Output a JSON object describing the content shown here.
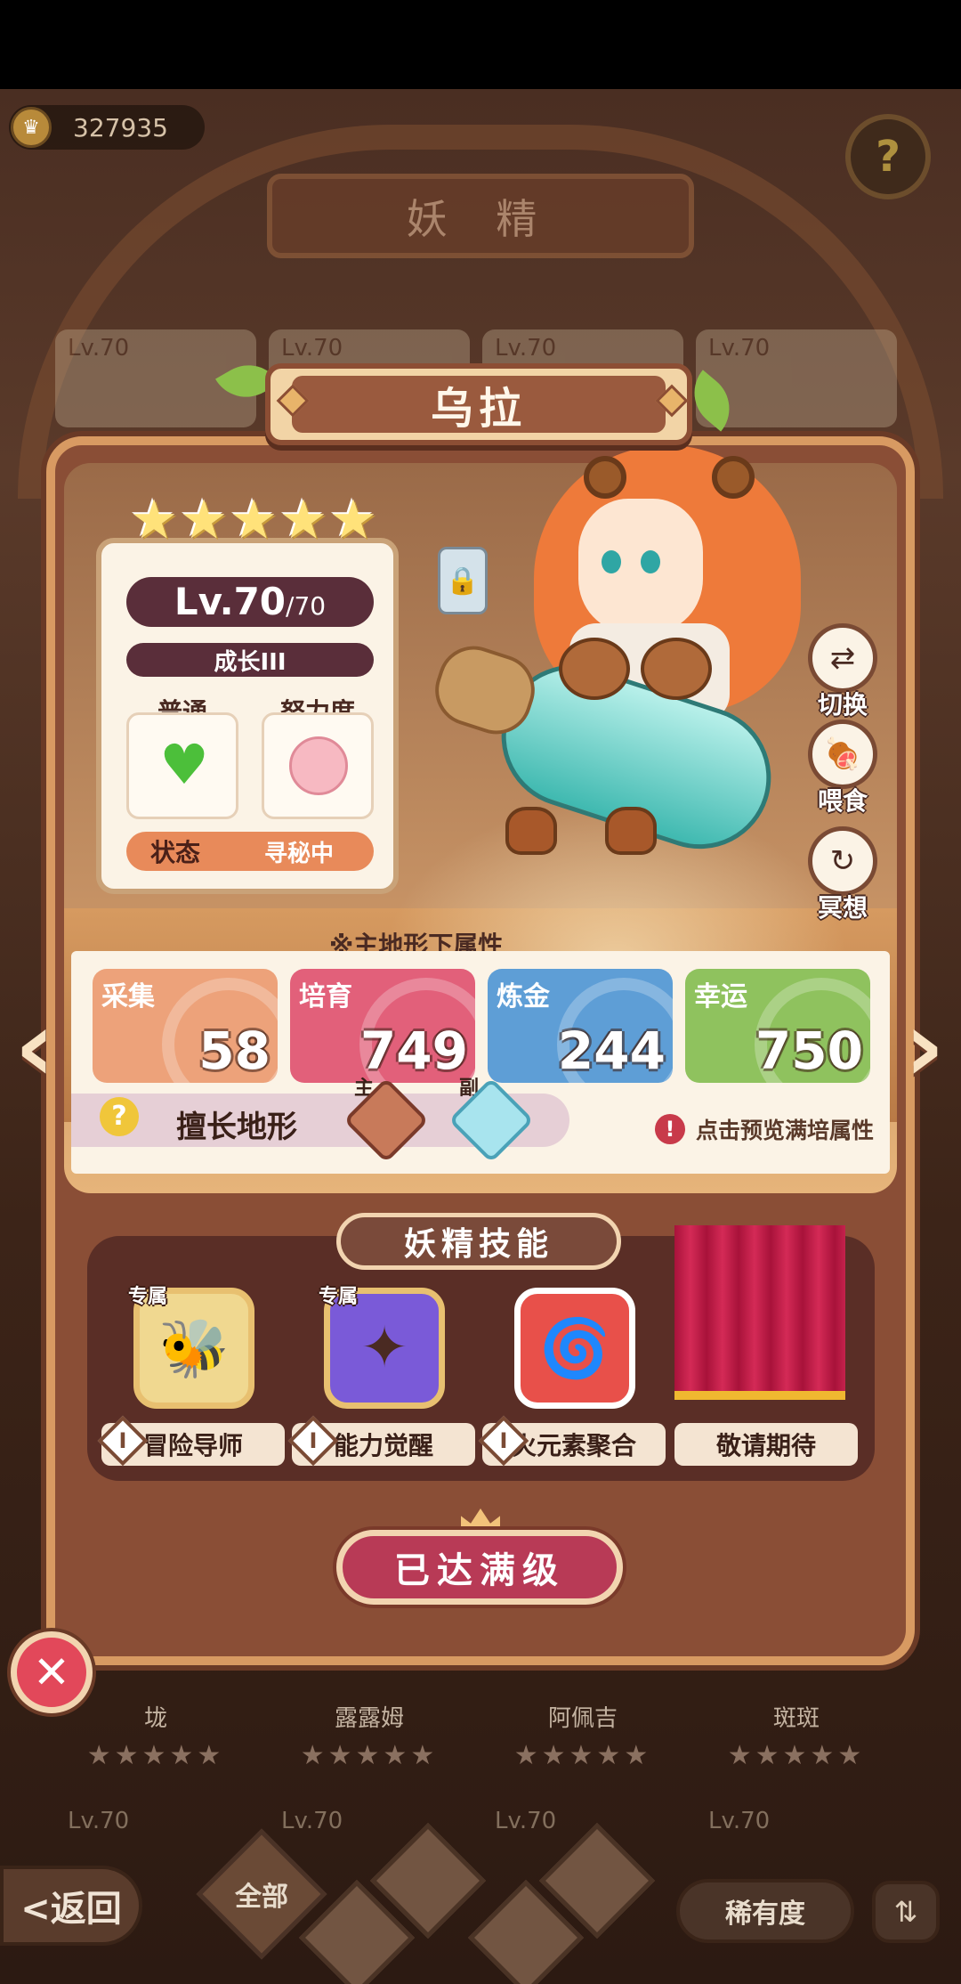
{
  "currency": {
    "icon": "crown-coin-icon",
    "amount": "327935"
  },
  "header": {
    "title": "妖 精"
  },
  "fairy": {
    "name": "乌拉",
    "stars": 5,
    "level": "Lv.70",
    "level_max": "/70",
    "growth": "成长III",
    "attr1_label": "普通",
    "attr2_label": "努力度",
    "status_label": "状态",
    "status_value": "寻秘中"
  },
  "side_actions": [
    {
      "label": "切换",
      "icon": "swap-icon"
    },
    {
      "label": "喂食",
      "icon": "meat-icon"
    },
    {
      "label": "冥想",
      "icon": "meditate-icon"
    }
  ],
  "attributes": {
    "note": "※主地形下属性",
    "stats": [
      {
        "name": "采集",
        "value": "58",
        "color": "#eda27a"
      },
      {
        "name": "培育",
        "value": "749",
        "color": "#e2607a"
      },
      {
        "name": "炼金",
        "value": "244",
        "color": "#5e9ed6"
      },
      {
        "name": "幸运",
        "value": "750",
        "color": "#8fc25e"
      }
    ],
    "terrain_label": "擅长地形",
    "terrain_main_tag": "主",
    "terrain_sub_tag": "副",
    "preview_hint": "点击预览满培属性"
  },
  "skills": {
    "title": "妖精技能",
    "items": [
      {
        "name": "冒险导师",
        "tag": "专属",
        "level": "I",
        "icon": "bee-icon",
        "color": "#f0d890"
      },
      {
        "name": "能力觉醒",
        "tag": "专属",
        "level": "I",
        "icon": "awaken-icon",
        "color": "#7a5ad8"
      },
      {
        "name": "火元素聚合",
        "tag": "",
        "level": "I",
        "icon": "fire-swirl-icon",
        "color": "#e8504a"
      },
      {
        "name": "敬请期待",
        "tag": "",
        "level": "",
        "icon": "curtain-icon",
        "color": "#c8204a"
      }
    ]
  },
  "max_button": "已达满级",
  "background_cards": {
    "levels": [
      "Lv.70",
      "Lv.70",
      "Lv.70",
      "Lv.70"
    ],
    "names": [
      "垅",
      "露露姆",
      "阿佩吉",
      "斑斑"
    ],
    "bottom_levels": [
      "Lv.70",
      "Lv.70",
      "Lv.70",
      "Lv.70"
    ]
  },
  "bottom_bar": {
    "back": "<返回",
    "filter_all": "全部",
    "rarity": "稀有度"
  }
}
